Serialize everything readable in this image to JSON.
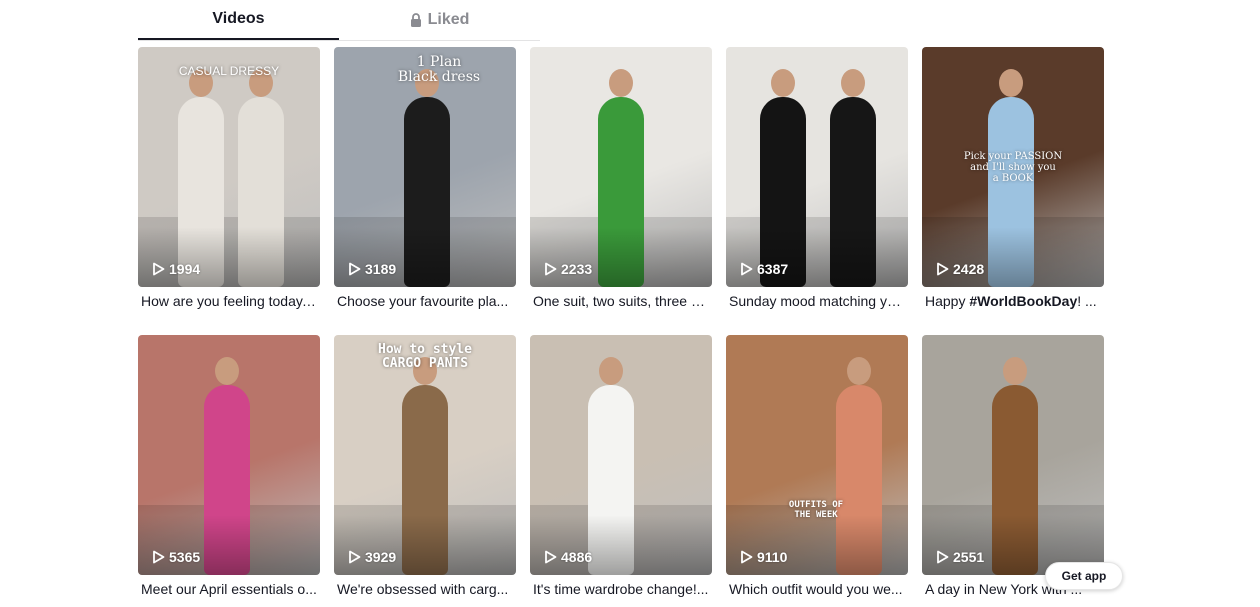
{
  "tabs": [
    {
      "label": "Videos",
      "active": true
    },
    {
      "label": "Liked",
      "active": false,
      "icon": "lock-icon"
    }
  ],
  "videos": [
    {
      "views": "1994",
      "caption": "How are you feeling today,...",
      "overlay": "CASUAL      DRESSY",
      "bg": "#cfcac4",
      "accent": "#e9e6e0"
    },
    {
      "views": "3189",
      "caption": "Choose your favourite pla...",
      "overlay": "1 Plan\nBlack dress",
      "bg": "#9da4ad",
      "accent": "#1f1f1f"
    },
    {
      "views": "2233",
      "caption": "One suit, two suits, three s...",
      "overlay": "",
      "bg": "#e9e7e3",
      "accent": "#3a9a3a"
    },
    {
      "views": "6387",
      "caption": "Sunday mood matching yo...",
      "overlay": "",
      "bg": "#e6e4e0",
      "accent": "#141414"
    },
    {
      "views": "2428",
      "caption_prefix": "Happy ",
      "caption_bold": "#WorldBookDay",
      "caption_suffix": "! ...",
      "overlay": "Pick your PASSION\nand I'll show you\na BOOK",
      "bg": "#5a3b2a",
      "accent": "#8fb4d6"
    },
    {
      "views": "5365",
      "caption": "Meet our April essentials o...",
      "overlay": "",
      "bg": "#b8756a",
      "accent": "#d0458a"
    },
    {
      "views": "3929",
      "caption": "We're obsessed with carg...",
      "overlay": "How to style\nCARGO PANTS",
      "bg": "#d8cfc4",
      "accent": "#e0552a"
    },
    {
      "views": "4886",
      "caption": "It's time wardrobe change!...",
      "overlay": "",
      "bg": "#c9bfb3",
      "accent": "#f4f4f2"
    },
    {
      "views": "9110",
      "caption": "Which outfit would you we...",
      "overlay": "OUTFITS OF\nTHE WEEK",
      "bg": "#b07a55",
      "accent": "#d8886a"
    },
    {
      "views": "2551",
      "caption": "A day in New York with ...",
      "overlay": "",
      "bg": "#a8a49c",
      "accent": "#8a5a32"
    }
  ],
  "get_app": "Get app"
}
